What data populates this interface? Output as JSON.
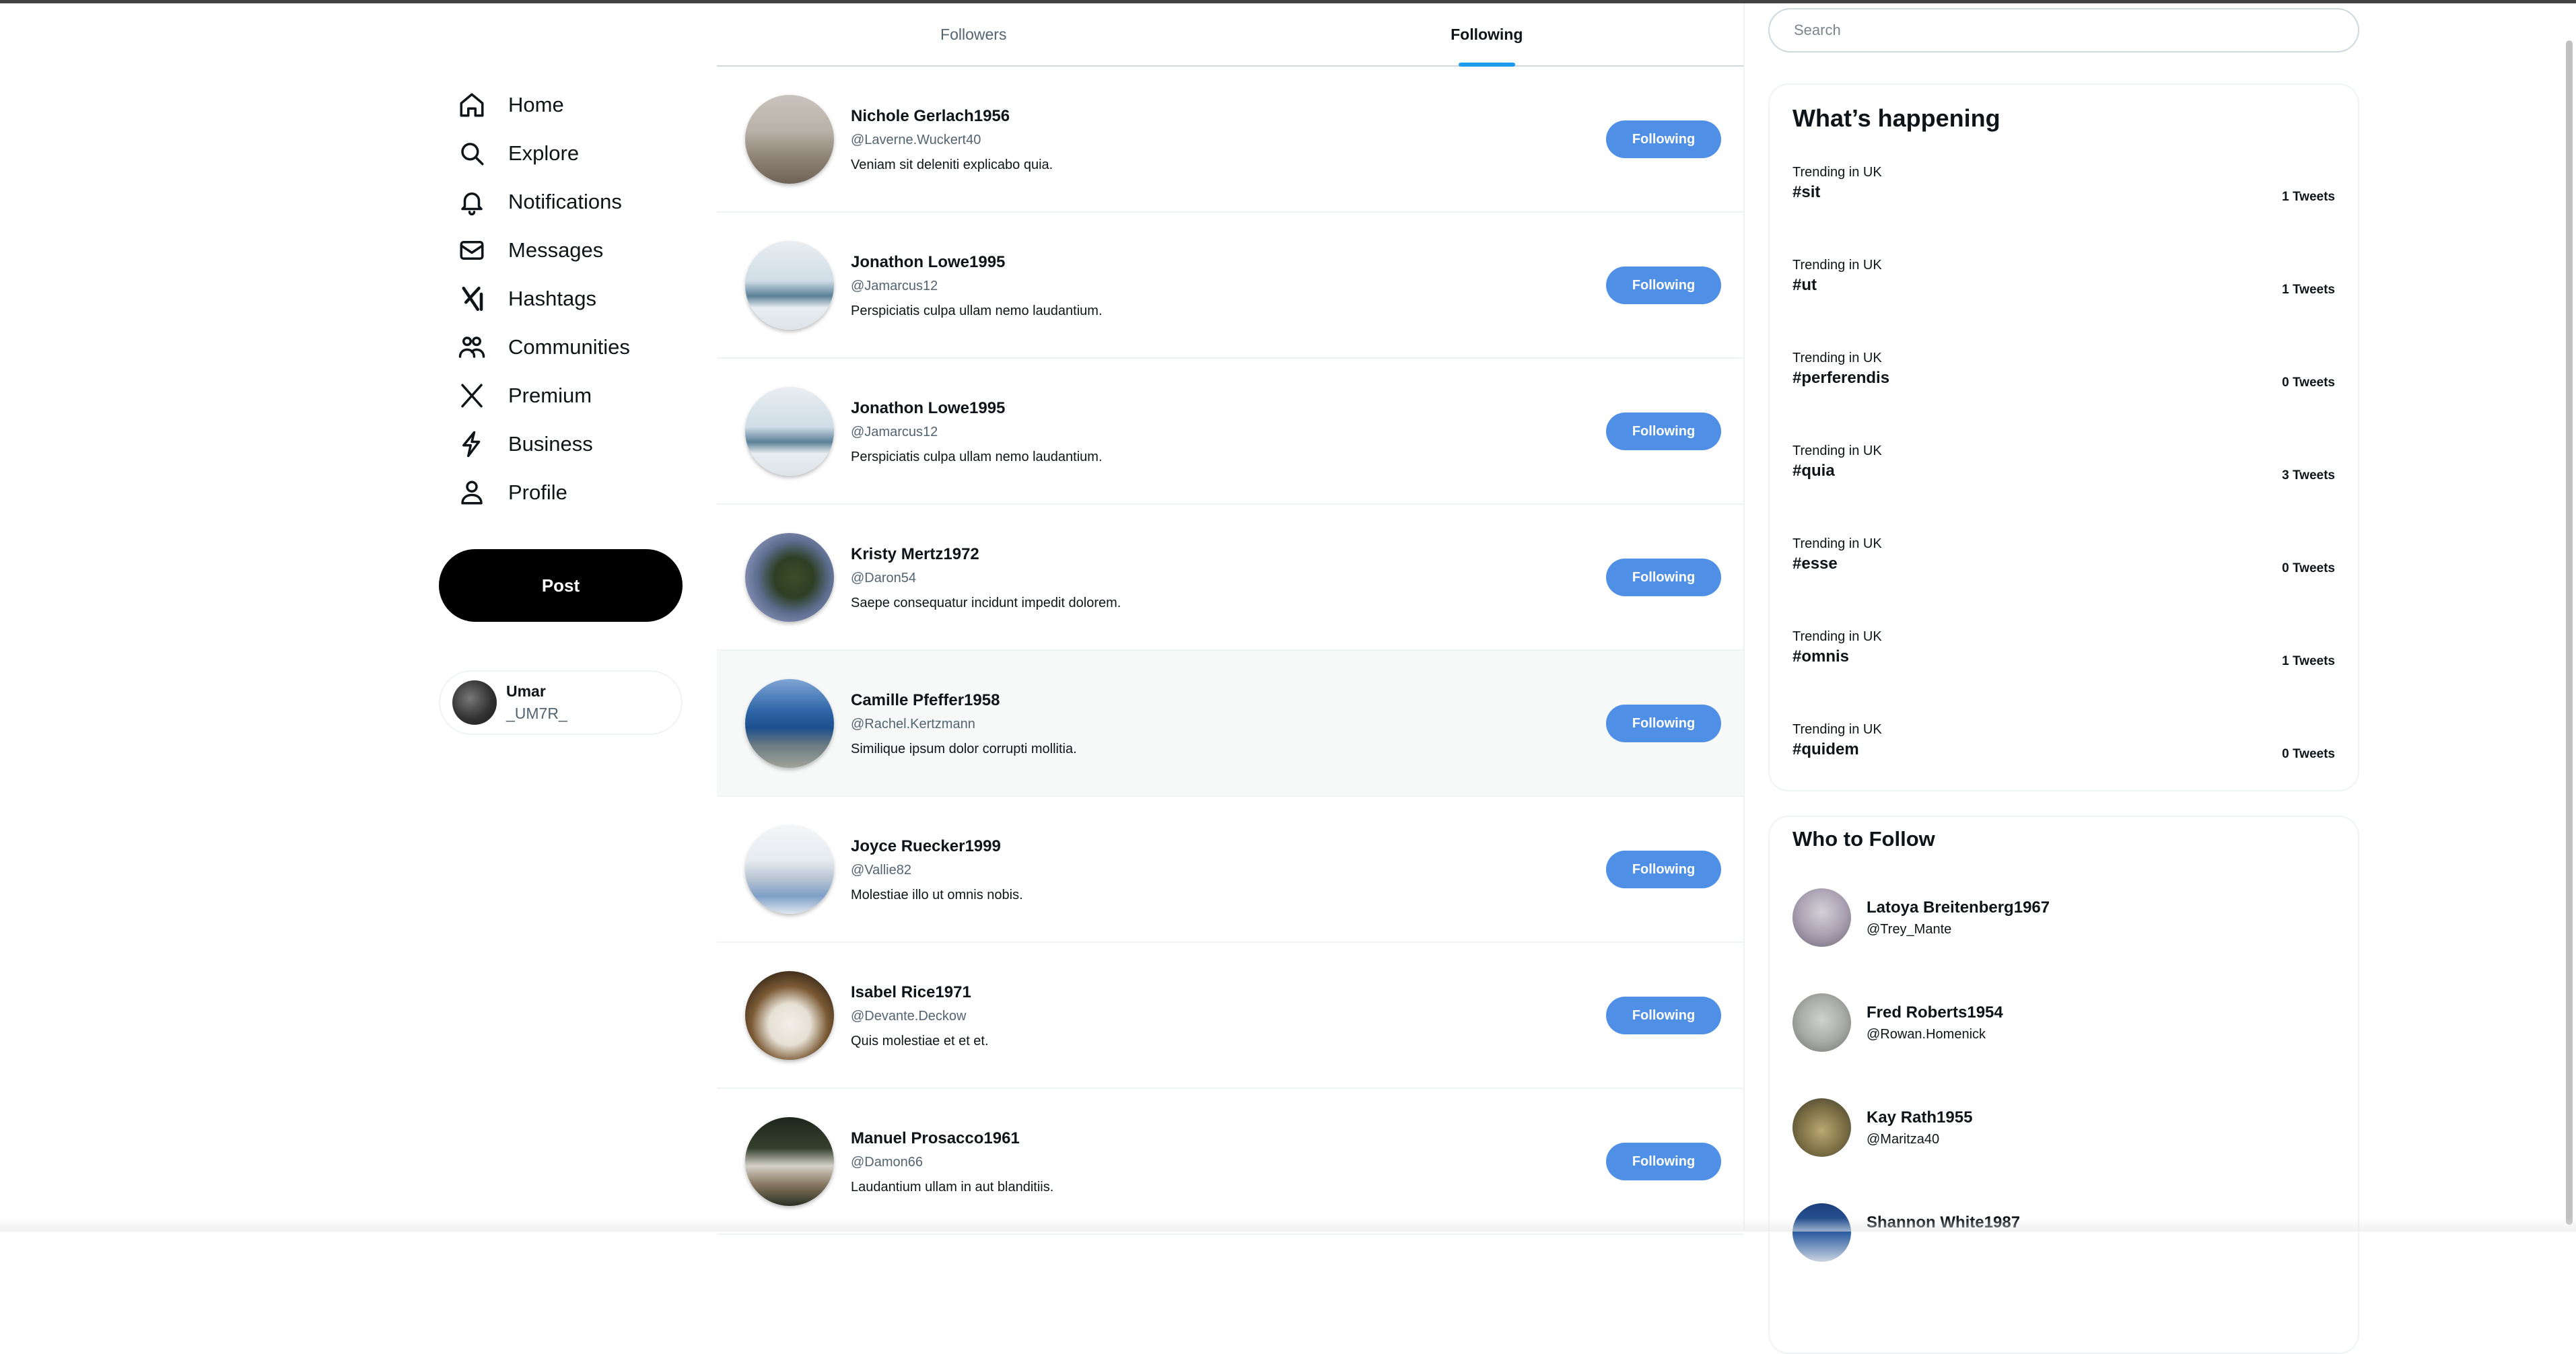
{
  "nav": {
    "items": [
      {
        "label": "Home",
        "icon": "home-icon"
      },
      {
        "label": "Explore",
        "icon": "search-icon"
      },
      {
        "label": "Notifications",
        "icon": "bell-icon"
      },
      {
        "label": "Messages",
        "icon": "envelope-icon"
      },
      {
        "label": "Hashtags",
        "icon": "x-logo-icon"
      },
      {
        "label": "Communities",
        "icon": "people-icon"
      },
      {
        "label": "Premium",
        "icon": "x-logo-icon"
      },
      {
        "label": "Business",
        "icon": "lightning-icon"
      },
      {
        "label": "Profile",
        "icon": "person-icon"
      }
    ],
    "post_label": "Post"
  },
  "user": {
    "name": "Umar",
    "handle": "_UM7R_"
  },
  "tabs": {
    "followers": "Followers",
    "following": "Following"
  },
  "following": [
    {
      "name": "Nichole Gerlach1956",
      "handle": "@Laverne.Wuckert40",
      "bio": "Veniam sit deleniti explicabo quia.",
      "button": "Following"
    },
    {
      "name": "Jonathon Lowe1995",
      "handle": "@Jamarcus12",
      "bio": "Perspiciatis culpa ullam nemo laudantium.",
      "button": "Following"
    },
    {
      "name": "Jonathon Lowe1995",
      "handle": "@Jamarcus12",
      "bio": "Perspiciatis culpa ullam nemo laudantium.",
      "button": "Following"
    },
    {
      "name": "Kristy Mertz1972",
      "handle": "@Daron54",
      "bio": "Saepe consequatur incidunt impedit dolorem.",
      "button": "Following"
    },
    {
      "name": "Camille Pfeffer1958",
      "handle": "@Rachel.Kertzmann",
      "bio": "Similique ipsum dolor corrupti mollitia.",
      "button": "Following"
    },
    {
      "name": "Joyce Ruecker1999",
      "handle": "@Vallie82",
      "bio": "Molestiae illo ut omnis nobis.",
      "button": "Following"
    },
    {
      "name": "Isabel Rice1971",
      "handle": "@Devante.Deckow",
      "bio": "Quis molestiae et et et.",
      "button": "Following"
    },
    {
      "name": "Manuel Prosacco1961",
      "handle": "@Damon66",
      "bio": "Laudantium ullam in aut blanditiis.",
      "button": "Following"
    }
  ],
  "search": {
    "placeholder": "Search"
  },
  "happening": {
    "title": "What’s happening",
    "trends": [
      {
        "location": "Trending in UK",
        "tag": "#sit",
        "count": "1 Tweets"
      },
      {
        "location": "Trending in UK",
        "tag": "#ut",
        "count": "1 Tweets"
      },
      {
        "location": "Trending in UK",
        "tag": "#perferendis",
        "count": "0 Tweets"
      },
      {
        "location": "Trending in UK",
        "tag": "#quia",
        "count": "3 Tweets"
      },
      {
        "location": "Trending in UK",
        "tag": "#esse",
        "count": "0 Tweets"
      },
      {
        "location": "Trending in UK",
        "tag": "#omnis",
        "count": "1 Tweets"
      },
      {
        "location": "Trending in UK",
        "tag": "#quidem",
        "count": "0 Tweets"
      }
    ]
  },
  "who_to_follow": {
    "title": "Who to Follow",
    "users": [
      {
        "name": "Latoya Breitenberg1967",
        "handle": "@Trey_Mante"
      },
      {
        "name": "Fred Roberts1954",
        "handle": "@Rowan.Homenick"
      },
      {
        "name": "Kay Rath1955",
        "handle": "@Maritza40"
      },
      {
        "name": "Shannon White1987",
        "handle": ""
      }
    ]
  },
  "colors": {
    "accent": "#4f8fe6",
    "tab_indicator": "#1d9bf0",
    "post_button": "#000000"
  }
}
